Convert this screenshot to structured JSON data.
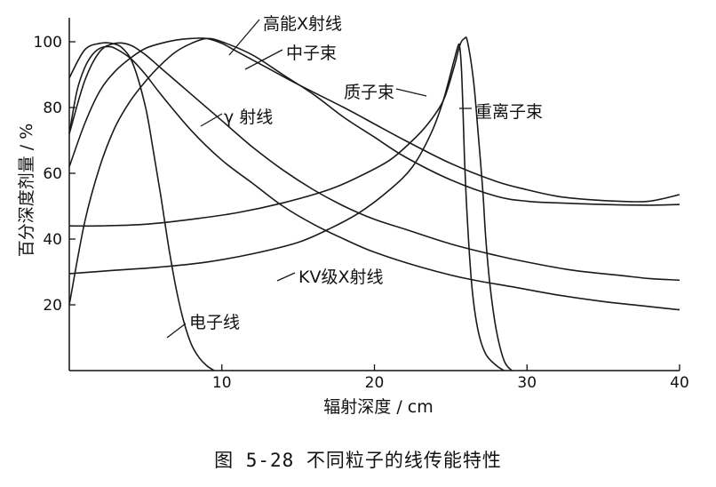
{
  "caption": "图 5-28 不同粒子的线传能特性",
  "chart_data": {
    "type": "line",
    "xlabel": "辐射深度 / cm",
    "ylabel": "百分深度剂量 / %",
    "xlim": [
      0,
      40
    ],
    "ylim": [
      0,
      105
    ],
    "x_ticks": [
      10,
      20,
      30,
      40
    ],
    "y_ticks": [
      20,
      40,
      60,
      80,
      100
    ],
    "grid": false,
    "legend": "none",
    "series": [
      {
        "name": "高能X射线",
        "points": [
          [
            0,
            62
          ],
          [
            1,
            75
          ],
          [
            2,
            85
          ],
          [
            3,
            91
          ],
          [
            4,
            95
          ],
          [
            5,
            98
          ],
          [
            6,
            99.5
          ],
          [
            7,
            100.5
          ],
          [
            8,
            101
          ],
          [
            9,
            101
          ],
          [
            10,
            99.5
          ],
          [
            11,
            97
          ],
          [
            13,
            92
          ],
          [
            15,
            87
          ],
          [
            18,
            80
          ],
          [
            20,
            75
          ],
          [
            22,
            70
          ],
          [
            25,
            63
          ],
          [
            28,
            57.5
          ],
          [
            30,
            55
          ],
          [
            32,
            53
          ],
          [
            34,
            52
          ],
          [
            36,
            51.5
          ],
          [
            38,
            51.5
          ],
          [
            40,
            53.5
          ]
        ]
      },
      {
        "name": "中子束",
        "points": [
          [
            0,
            20
          ],
          [
            1,
            45
          ],
          [
            2,
            62
          ],
          [
            3,
            74
          ],
          [
            4,
            82
          ],
          [
            5,
            88
          ],
          [
            6,
            93
          ],
          [
            7,
            97
          ],
          [
            8,
            99.5
          ],
          [
            9,
            101
          ],
          [
            10,
            100
          ],
          [
            12,
            96
          ],
          [
            14,
            90
          ],
          [
            16,
            84
          ],
          [
            18,
            77
          ],
          [
            20,
            71
          ],
          [
            22,
            65
          ],
          [
            25,
            58
          ],
          [
            28,
            53
          ],
          [
            30,
            51.5
          ],
          [
            32,
            51
          ],
          [
            35,
            50.5
          ],
          [
            38,
            50.3
          ],
          [
            40,
            50.5
          ]
        ]
      },
      {
        "name": "γ 射线",
        "points": [
          [
            0,
            72
          ],
          [
            1,
            88
          ],
          [
            2,
            97
          ],
          [
            3,
            99.5
          ],
          [
            4,
            99
          ],
          [
            5,
            96
          ],
          [
            6,
            92
          ],
          [
            8,
            84
          ],
          [
            10,
            76
          ],
          [
            12,
            68
          ],
          [
            14,
            61
          ],
          [
            16,
            55
          ],
          [
            18,
            50
          ],
          [
            20,
            46
          ],
          [
            22,
            43
          ],
          [
            25,
            38.5
          ],
          [
            28,
            35
          ],
          [
            30,
            33
          ],
          [
            33,
            30.5
          ],
          [
            36,
            29
          ],
          [
            38,
            28
          ],
          [
            40,
            27.5
          ]
        ]
      },
      {
        "name": "电子线",
        "points": [
          [
            0,
            89
          ],
          [
            1,
            97.5
          ],
          [
            2,
            99.5
          ],
          [
            2.8,
            99.5
          ],
          [
            3.5,
            98
          ],
          [
            4.2,
            93
          ],
          [
            5,
            80
          ],
          [
            5.5,
            67
          ],
          [
            6,
            53
          ],
          [
            6.5,
            38
          ],
          [
            7,
            25
          ],
          [
            7.5,
            15
          ],
          [
            8,
            8
          ],
          [
            8.5,
            4
          ],
          [
            9,
            1.5
          ],
          [
            9.5,
            0
          ]
        ]
      },
      {
        "name": "质子束",
        "points": [
          [
            0,
            44
          ],
          [
            2,
            44
          ],
          [
            5,
            44.5
          ],
          [
            8,
            46
          ],
          [
            11,
            48
          ],
          [
            14,
            51
          ],
          [
            17,
            55
          ],
          [
            19,
            59
          ],
          [
            21,
            64
          ],
          [
            22.5,
            70
          ],
          [
            23.5,
            75
          ],
          [
            24.5,
            82
          ],
          [
            25.2,
            92
          ],
          [
            25.6,
            99
          ],
          [
            25.9,
            101
          ],
          [
            26.1,
            100
          ],
          [
            26.5,
            88
          ],
          [
            26.8,
            72
          ],
          [
            27.1,
            55
          ],
          [
            27.3,
            40
          ],
          [
            27.6,
            25
          ],
          [
            28,
            12
          ],
          [
            28.5,
            3
          ],
          [
            29,
            0
          ]
        ]
      },
      {
        "name": "重离子束",
        "points": [
          [
            0,
            29.5
          ],
          [
            3,
            30.5
          ],
          [
            6,
            31.5
          ],
          [
            9,
            33
          ],
          [
            12,
            35.5
          ],
          [
            15,
            39
          ],
          [
            17,
            43
          ],
          [
            19,
            48
          ],
          [
            21,
            55
          ],
          [
            22.5,
            62
          ],
          [
            23.7,
            72
          ],
          [
            24.5,
            82
          ],
          [
            25.2,
            94
          ],
          [
            25.5,
            99
          ],
          [
            25.6,
            98
          ],
          [
            25.7,
            92
          ],
          [
            25.8,
            80
          ],
          [
            25.9,
            65
          ],
          [
            26.1,
            45
          ],
          [
            26.4,
            25
          ],
          [
            26.8,
            12
          ],
          [
            27.3,
            5
          ],
          [
            28,
            1.5
          ],
          [
            28.5,
            0
          ]
        ]
      },
      {
        "name": "KV级X射线",
        "points": [
          [
            0,
            72
          ],
          [
            0.5,
            85
          ],
          [
            1,
            92
          ],
          [
            1.5,
            96
          ],
          [
            2,
            98
          ],
          [
            2.5,
            98.5
          ],
          [
            3,
            98
          ],
          [
            4,
            95
          ],
          [
            5,
            90
          ],
          [
            6,
            84
          ],
          [
            8,
            73
          ],
          [
            10,
            64
          ],
          [
            12,
            57
          ],
          [
            14,
            50
          ],
          [
            16,
            44.5
          ],
          [
            18,
            40
          ],
          [
            20,
            36
          ],
          [
            23,
            31.5
          ],
          [
            26,
            28
          ],
          [
            29,
            25.5
          ],
          [
            32,
            23
          ],
          [
            35,
            21
          ],
          [
            38,
            19.5
          ],
          [
            40,
            18.5
          ]
        ]
      }
    ],
    "annotations": [
      {
        "text": "高能X射线",
        "series": "高能X射线"
      },
      {
        "text": "中子束",
        "series": "中子束"
      },
      {
        "text": "γ 射线",
        "series": "γ 射线"
      },
      {
        "text": "质子束",
        "series": "质子束"
      },
      {
        "text": "重离子束",
        "series": "重离子束"
      },
      {
        "text": "KV级X射线",
        "series": "KV级X射线"
      },
      {
        "text": "电子线",
        "series": "电子线"
      }
    ]
  }
}
